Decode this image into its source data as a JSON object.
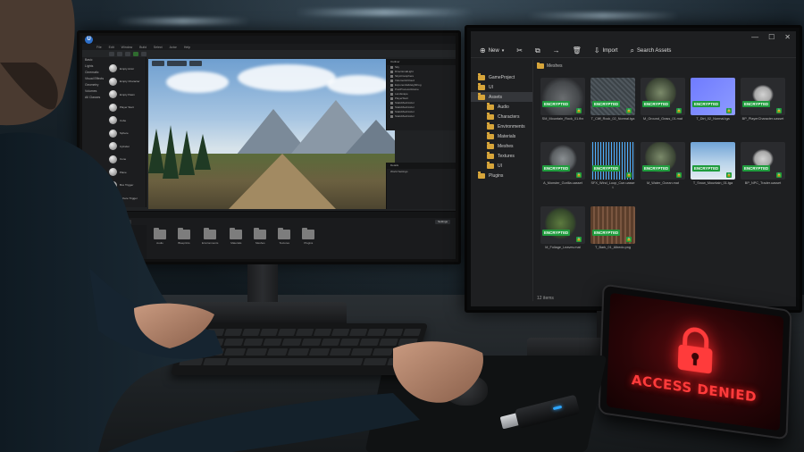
{
  "left_editor": {
    "logo_letter": "U",
    "menu": [
      "File",
      "Edit",
      "Window",
      "Build",
      "Select",
      "Actor",
      "Help"
    ],
    "place_panel_items": [
      "Empty Actor",
      "Empty Character",
      "Empty Pawn",
      "Player Start",
      "Cube",
      "Sphere",
      "Cylinder",
      "Cone",
      "Plane",
      "Box Trigger",
      "Sphere Trigger"
    ],
    "place_categories": [
      "Basic",
      "Lights",
      "Cinematic",
      "Visual Effects",
      "Geometry",
      "Volumes",
      "All Classes"
    ],
    "outliner_label": "Outliner",
    "outliner_rows": [
      "Sky",
      "DirectionalLight",
      "SkyAtmosphere",
      "VolumetricCloud",
      "ExponentialHeightFog",
      "PostProcessVolume",
      "Landscape",
      "PlayerStart",
      "StaticMeshActor",
      "StaticMeshActor",
      "StaticMeshActor",
      "StaticMeshActor"
    ],
    "details_label": "Details",
    "details_world_settings": "World Settings",
    "content_browser_label": "Content Browser",
    "content_buttons": [
      "Add",
      "Import",
      "Save All"
    ],
    "content_settings": "Settings",
    "folders": [
      "Audio",
      "Blueprints",
      "Environments",
      "Materials",
      "Meshes",
      "Textures",
      "Plugins"
    ]
  },
  "asset_browser": {
    "window_controls": [
      "—",
      "☐",
      "✕"
    ],
    "toolbar": {
      "new_label": "New",
      "import_label": "Import",
      "search_label": "Search Assets"
    },
    "path": "Meshes",
    "tree": [
      {
        "label": "GameProject",
        "child": false,
        "selected": false
      },
      {
        "label": "UI",
        "child": false,
        "selected": false
      },
      {
        "label": "Assets",
        "child": false,
        "selected": true
      },
      {
        "label": "Audio",
        "child": true,
        "selected": false
      },
      {
        "label": "Characters",
        "child": true,
        "selected": false
      },
      {
        "label": "Environments",
        "child": true,
        "selected": false
      },
      {
        "label": "Materials",
        "child": true,
        "selected": false
      },
      {
        "label": "Meshes",
        "child": true,
        "selected": false
      },
      {
        "label": "Textures",
        "child": true,
        "selected": false
      },
      {
        "label": "UI",
        "child": true,
        "selected": false
      },
      {
        "label": "Plugins",
        "child": false,
        "selected": false
      }
    ],
    "badge_text": "ENCRYPTED",
    "assets": [
      {
        "name": "SM_Mountain_Rock_01.fbx",
        "thumb": "rock"
      },
      {
        "name": "T_Cliff_Rock_02_Normal.tga",
        "thumb": "texture"
      },
      {
        "name": "M_Ground_Grass_01.mat",
        "thumb": "sphere"
      },
      {
        "name": "T_Dirt_02_Normal.tga",
        "thumb": "normal"
      },
      {
        "name": "BP_PlayerCharacter.uasset",
        "thumb": "character"
      },
      {
        "name": "A_Monster_Gorilla.uasset",
        "thumb": "creature"
      },
      {
        "name": "SFX_Wind_Loop_Cue.uasset",
        "thumb": "audio"
      },
      {
        "name": "M_Water_Ocean.mat",
        "thumb": "sphere"
      },
      {
        "name": "T_Snow_Mountain_01.tga",
        "thumb": "mountain"
      },
      {
        "name": "BP_NPC_Trader.uasset",
        "thumb": "character"
      },
      {
        "name": "M_Foliage_Leaves.mat",
        "thumb": "foliage"
      },
      {
        "name": "T_Bark_01_Albedo.png",
        "thumb": "bark"
      }
    ],
    "item_count": "12 items"
  },
  "tablet": {
    "message": "ACCESS DENIED",
    "screen_color": "#ff3b3b"
  },
  "colors": {
    "encrypted_badge": "#1f9c3d",
    "folder": "#d7a53a",
    "alert_red": "#ff3b3b"
  }
}
